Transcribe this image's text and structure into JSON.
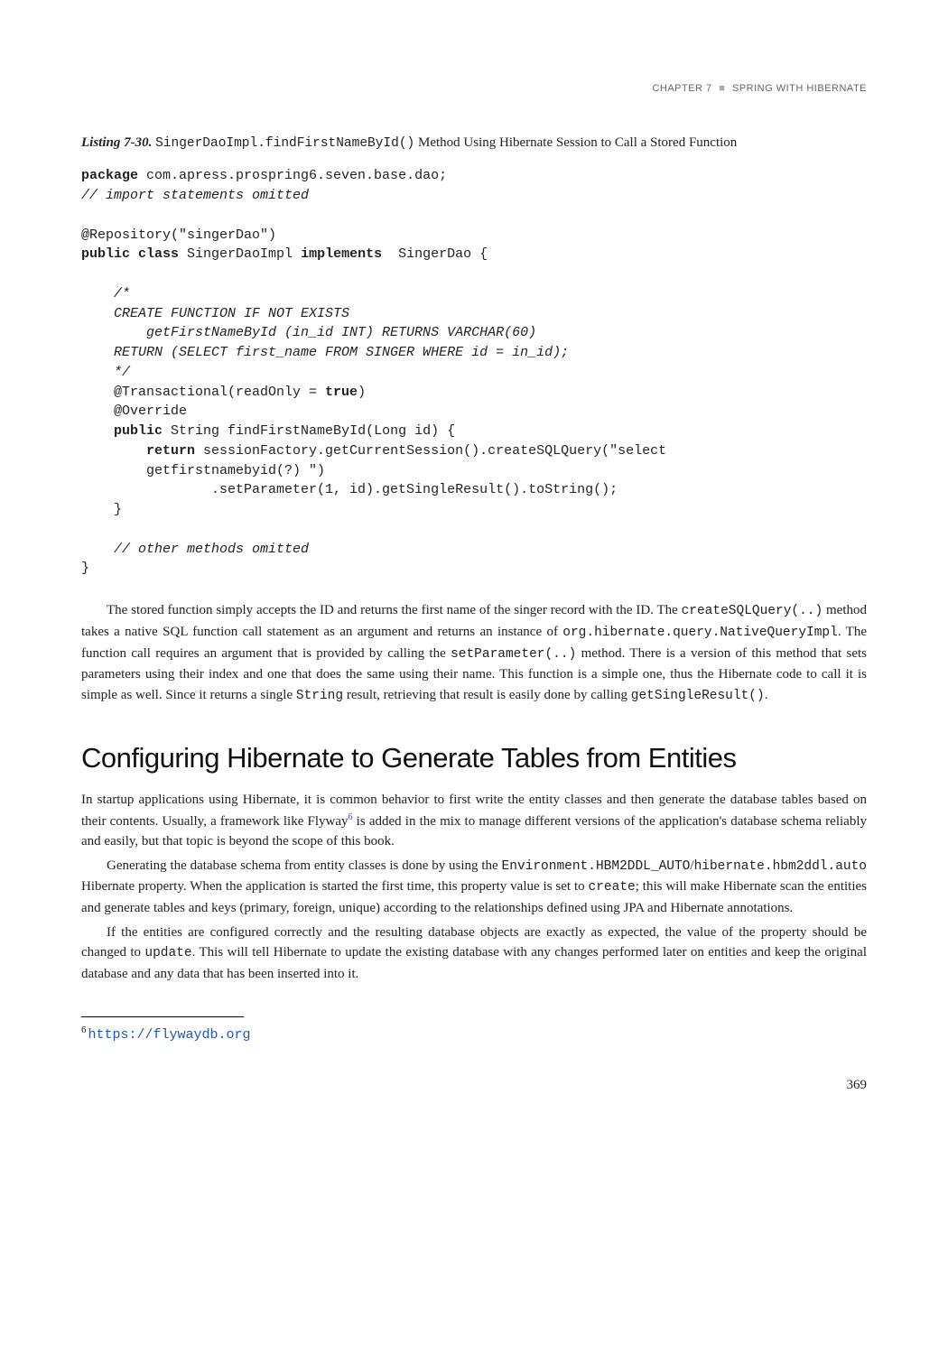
{
  "header": {
    "chapter": "CHAPTER 7",
    "title": "SPRING WITH HIBERNATE"
  },
  "listing": {
    "label": "Listing 7-30.",
    "signature": "SingerDaoImpl.findFirstNameById()",
    "caption_tail": " Method Using Hibernate Session to Call a Stored Function"
  },
  "code": {
    "l01a": "package",
    "l01b": " com.apress.prospring6.seven.base.dao;",
    "l02": "// import statements omitted",
    "l03": "@Repository(\"singerDao\")",
    "l04a": "public class",
    "l04b": " SingerDaoImpl ",
    "l04c": "implements",
    "l04d": "  SingerDao {",
    "l05": "    /*",
    "l06": "    CREATE FUNCTION IF NOT EXISTS",
    "l07": "        getFirstNameById (in_id INT) RETURNS VARCHAR(60)",
    "l08": "    RETURN (SELECT first_name FROM SINGER WHERE id = in_id);",
    "l09": "    */",
    "l10a": "    @Transactional(readOnly = ",
    "l10b": "true",
    "l10c": ")",
    "l11": "    @Override",
    "l12a": "    ",
    "l12b": "public",
    "l12c": " String findFirstNameById(Long id) {",
    "l13a": "        ",
    "l13b": "return",
    "l13c": " sessionFactory.getCurrentSession().createSQLQuery(\"select ",
    "l14": "        getfirstnamebyid(?) \")",
    "l15": "                .setParameter(1, id).getSingleResult().toString();",
    "l16": "    }",
    "l17": "    // other methods omitted",
    "l18": "}"
  },
  "para1_a": "The stored function simply accepts the ID and returns the first name of the singer record with the ID. The ",
  "para1_b": "createSQLQuery(..)",
  "para1_c": " method takes a native SQL function call statement as an argument and returns an instance of ",
  "para1_d": "org.hibernate.query.NativeQueryImpl",
  "para1_e": ". The function call requires an argument that is provided by calling the ",
  "para1_f": "setParameter(..)",
  "para1_g": " method. There is a version of this method that sets parameters using their index and one that does the same using their name. This function is a simple one, thus the Hibernate code to call it is simple as well. Since it returns a single ",
  "para1_h": "String",
  "para1_i": " result, retrieving that result is easily done by calling ",
  "para1_j": "getSingleResult()",
  "para1_k": ".",
  "section_heading": "Configuring Hibernate to Generate Tables from Entities",
  "para2_a": "In startup applications using Hibernate, it is common behavior to first write the entity classes and then generate the database tables based on their contents. Usually, a framework like Flyway",
  "para2_fn": "6",
  "para2_b": " is added in the mix to manage different versions of the application's database schema reliably and easily, but that topic is beyond the scope of this book.",
  "para3_a": "Generating the database schema from entity classes is done by using the ",
  "para3_b": "Environment.HBM2DDL_AUTO",
  "para3_c": "/",
  "para3_d": "hibernate.hbm2ddl.auto",
  "para3_e": " Hibernate property. When the application is started the first time, this property value is set to ",
  "para3_f": "create",
  "para3_g": "; this will make Hibernate scan the entities and generate tables and keys (primary, foreign, unique) according to the relationships defined using JPA and Hibernate annotations.",
  "para4_a": "If the entities are configured correctly and the resulting database objects are exactly as expected, the value of the property should be changed to ",
  "para4_b": "update",
  "para4_c": ". This will tell Hibernate to update the existing database with any changes performed later on entities and keep the original database and any data that has been inserted into it.",
  "footnote": {
    "num": "6",
    "url": "https://flywaydb.org"
  },
  "pagenum": "369"
}
